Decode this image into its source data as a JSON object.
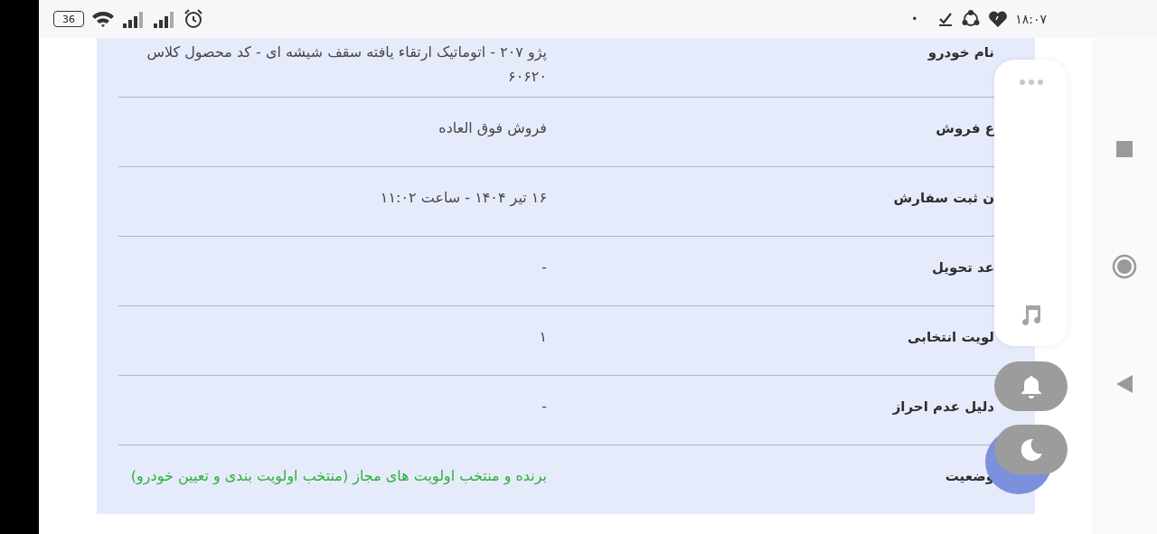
{
  "status_bar": {
    "battery": "36",
    "notification_dot": "•",
    "time": "۱۸:۰۷"
  },
  "order_details": [
    {
      "label": "نام خودرو",
      "value": "پژو ۲۰۷ - اتوماتیک ارتقاء یافته سقف شیشه ای - کد محصول کلاس ۶۰۶۲۰",
      "kind": "plain"
    },
    {
      "label": "ع فروش",
      "value": "فروش فوق العاده",
      "kind": "plain"
    },
    {
      "label": "ن ثبت سفارش",
      "value": "۱۶ تیر ۱۴۰۴ - ساعت ۱۱:۰۲",
      "kind": "plain"
    },
    {
      "label": "عد تحویل",
      "value": "-",
      "kind": "plain"
    },
    {
      "label": "لویت انتخابی",
      "value": "۱",
      "kind": "plain"
    },
    {
      "label": "دلیل عدم احراز",
      "value": "-",
      "kind": "plain"
    },
    {
      "label": "وضعیت",
      "value": "برنده و منتخب اولویت های مجاز (منتخب اولویت بندی و تعیین خودرو)",
      "kind": "success"
    }
  ]
}
